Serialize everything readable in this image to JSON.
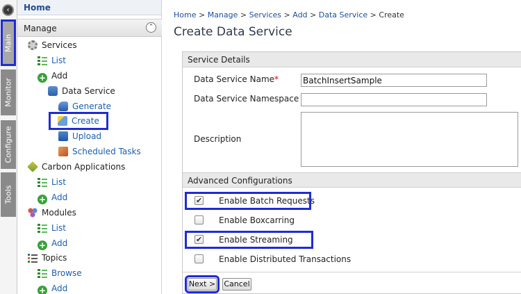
{
  "sidebar_tabs": [
    {
      "label": "Main",
      "active": true
    },
    {
      "label": "Monitor"
    },
    {
      "label": "Configure"
    },
    {
      "label": "Tools"
    }
  ],
  "nav": {
    "home": "Home",
    "section": "Manage",
    "services": "Services",
    "services_list": "List",
    "services_add": "Add",
    "data_service": "Data Service",
    "generate": "Generate",
    "create": "Create",
    "upload": "Upload",
    "scheduled_tasks": "Scheduled Tasks",
    "carbon_applications": "Carbon Applications",
    "carbon_list": "List",
    "carbon_add": "Add",
    "modules": "Modules",
    "modules_list": "List",
    "modules_add": "Add",
    "topics": "Topics",
    "topics_browse": "Browse",
    "topics_add": "Add"
  },
  "breadcrumb": [
    "Home",
    "Manage",
    "Services",
    "Add",
    "Data Service",
    "Create"
  ],
  "page_title": "Create Data Service",
  "service_details": {
    "header": "Service Details",
    "name_label": "Data Service Name",
    "required_mark": "*",
    "name_value": "BatchInsertSample",
    "namespace_label": "Data Service Namespace",
    "namespace_value": "",
    "description_label": "Description",
    "description_value": ""
  },
  "advanced": {
    "header": "Advanced Configurations",
    "options": [
      {
        "label": "Enable Batch Requests",
        "checked": true
      },
      {
        "label": "Enable Boxcarring",
        "checked": false
      },
      {
        "label": "Enable Streaming",
        "checked": true
      },
      {
        "label": "Enable Distributed Transactions",
        "checked": false
      }
    ]
  },
  "buttons": {
    "next": "Next >",
    "cancel": "Cancel"
  },
  "colors": {
    "highlight": "#1f2bd6",
    "link": "#1b5fae"
  }
}
